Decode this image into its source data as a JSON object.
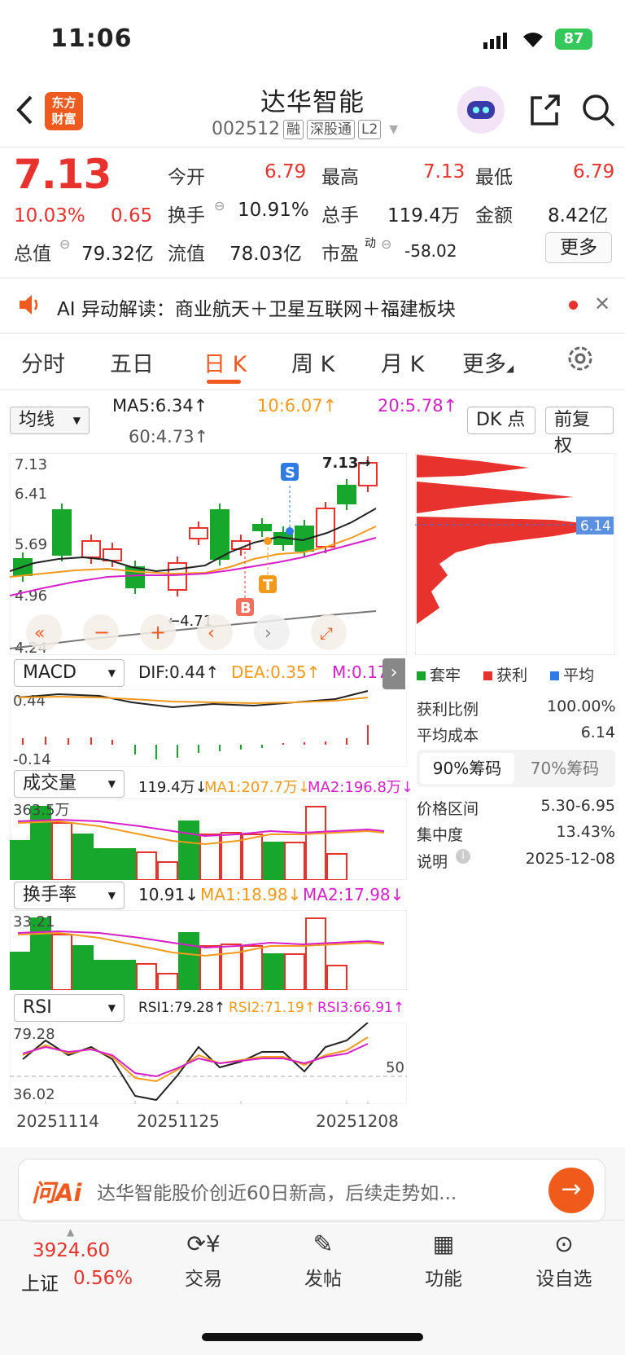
{
  "status_bar": {
    "time": "11:06",
    "battery": "87"
  },
  "header": {
    "title": "达华智能",
    "code": "002512",
    "tags": [
      "融",
      "深股通",
      "L2"
    ],
    "logo_text": [
      "东方",
      "财富"
    ]
  },
  "quote": {
    "price": "7.13",
    "change_pct": "10.03%",
    "change": "0.65",
    "open_label": "今开",
    "open": "6.79",
    "high_label": "最高",
    "high": "7.13",
    "low_label": "最低",
    "low": "6.79",
    "turnover_label": "换手",
    "turnover": "10.91%",
    "volume_label": "总手",
    "volume": "119.4万",
    "amount_label": "金额",
    "amount": "8.42亿",
    "mktcap_label": "总值",
    "mktcap": "79.32亿",
    "float_label": "流值",
    "float": "78.03亿",
    "pe_label": "市盈",
    "pe_sup": "动",
    "pe": "-58.02",
    "more_label": "更多"
  },
  "banner": {
    "text": "AI 异动解读：商业航天＋卫星互联网＋福建板块"
  },
  "tabs": [
    "分时",
    "五日",
    "日 K",
    "周 K",
    "月 K",
    "更多"
  ],
  "ma_bar": {
    "select": "均线",
    "ma5": "MA5:6.34↑",
    "ma10": "10:6.07↑",
    "ma20": "20:5.78↑",
    "ma60": "60:4.73↑",
    "dk": "DK 点",
    "fuquan": "前复权"
  },
  "kline": {
    "y_ticks": [
      "7.13",
      "6.41",
      "5.69",
      "4.96",
      "4.24"
    ],
    "high_note": "7.13→",
    "low_note": "←4.71",
    "markers": [
      "S",
      "T",
      "B"
    ]
  },
  "chips": {
    "price_tag": "6.14",
    "legend": [
      "套牢",
      "获利",
      "平均"
    ],
    "legend_colors": [
      "#16a72c",
      "#e8322e",
      "#2e7be8"
    ],
    "rows": [
      [
        "获利比例",
        "100.00%"
      ],
      [
        "平均成本",
        "6.14"
      ]
    ],
    "toggle": [
      "90%筹码",
      "70%筹码"
    ],
    "rows2": [
      [
        "价格区间",
        "5.30-6.95"
      ],
      [
        "集中度",
        "13.43%"
      ],
      [
        "说明",
        "2025-12-08"
      ]
    ]
  },
  "macd": {
    "select": "MACD",
    "dif": "DIF:0.44↑",
    "dea": "DEA:0.35↑",
    "m": "M:0.17",
    "ticks": [
      "0.44",
      "-0.14"
    ]
  },
  "volume": {
    "select": "成交量",
    "val": "119.4万↓",
    "ma1": "MA1:207.7万↓",
    "ma2": "MA2:196.8万↓",
    "tick": "363.5万"
  },
  "turnover": {
    "select": "换手率",
    "val": "10.91↓",
    "ma1": "MA1:18.98↓",
    "ma2": "MA2:17.98↓",
    "tick": "33.21"
  },
  "rsi": {
    "select": "RSI",
    "rsi1": "RSI1:79.28↑",
    "rsi2": "RSI2:71.19↑",
    "rsi3": "RSI3:66.91↑",
    "ticks": [
      "79.28",
      "36.02"
    ],
    "mid": "50"
  },
  "dates": [
    "20251114",
    "20251125",
    "20251208"
  ],
  "ai_bar": {
    "logo": "问Ai",
    "placeholder": "达华智能股价创近60日新高，后续走势如..."
  },
  "bottom_nav": {
    "index_value": "3924.60",
    "index_name": "上证",
    "index_change": "0.56%",
    "items": [
      "交易",
      "发帖",
      "功能",
      "设自选"
    ]
  }
}
